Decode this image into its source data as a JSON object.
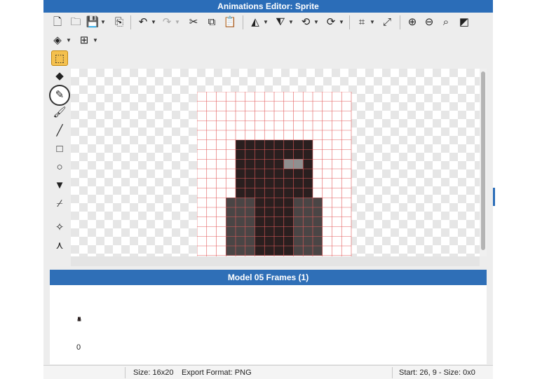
{
  "window": {
    "title": "Animations Editor: Sprite"
  },
  "toolbar": {
    "row1": [
      {
        "name": "new-file-icon",
        "glyph": "🗋"
      },
      {
        "name": "open-folder-icon",
        "glyph": "🗀"
      },
      {
        "name": "save-icon",
        "glyph": "💾"
      },
      {
        "name": "export-icon",
        "glyph": "⎘"
      },
      {
        "name": "undo-icon",
        "glyph": "↶"
      },
      {
        "name": "redo-icon",
        "glyph": "↷"
      },
      {
        "name": "cut-icon",
        "glyph": "✂"
      },
      {
        "name": "copy-icon",
        "glyph": "⧉"
      },
      {
        "name": "paste-icon",
        "glyph": "📋"
      },
      {
        "name": "flip-horizontal-icon",
        "glyph": "◭"
      },
      {
        "name": "flip-vertical-icon",
        "glyph": "⧨"
      },
      {
        "name": "rotate-left-icon",
        "glyph": "⟲"
      },
      {
        "name": "rotate-right-icon",
        "glyph": "⟳"
      },
      {
        "name": "crop-icon",
        "glyph": "⌗"
      },
      {
        "name": "resize-icon",
        "glyph": "⤢"
      },
      {
        "name": "zoom-in-icon",
        "glyph": "⊕"
      },
      {
        "name": "zoom-out-icon",
        "glyph": "⊖"
      },
      {
        "name": "zoom-fit-icon",
        "glyph": "⌕"
      },
      {
        "name": "invert-icon",
        "glyph": "◩"
      }
    ],
    "row2": [
      {
        "name": "layers-icon",
        "glyph": "◈"
      },
      {
        "name": "grid-icon",
        "glyph": "⊞"
      }
    ]
  },
  "tools": [
    {
      "name": "select-rect-tool",
      "glyph": "⬚",
      "active": true
    },
    {
      "name": "eraser-tool",
      "glyph": "◆"
    },
    {
      "name": "pencil-tool",
      "glyph": "✎"
    },
    {
      "name": "brush-tool",
      "glyph": "🖌"
    },
    {
      "name": "line-tool",
      "glyph": "╱"
    },
    {
      "name": "rectangle-tool",
      "glyph": "□"
    },
    {
      "name": "ellipse-tool",
      "glyph": "○"
    },
    {
      "name": "fill-bucket-tool",
      "glyph": "▼"
    },
    {
      "name": "eyedropper-tool",
      "glyph": "⌿"
    },
    {
      "name": "pivot-tool",
      "glyph": "✧"
    },
    {
      "name": "bones-tool",
      "glyph": "⋏"
    }
  ],
  "sprite": {
    "width": 16,
    "height": 20,
    "rows": [
      "................",
      "................",
      "................",
      "................",
      "................",
      "....88888888....",
      "....88888888....",
      "....88888GG8....",
      "....88888888....",
      "....88888888....",
      "....88888888....",
      "...3338888333...",
      "...3338888333...",
      "...3338888333...",
      "...3338888333...",
      "...3338888333...",
      "...3338888333...",
      "................",
      "................",
      "................"
    ],
    "palette": {
      "8": "#2a1f1f",
      "3": "#4a4545",
      "G": "#8f8f8f"
    },
    "grid_color": "#e35c5c"
  },
  "frames": {
    "title": "Model 05 Frames (1)",
    "items": [
      {
        "index": "0"
      }
    ]
  },
  "status": {
    "size": "Size: 16x20",
    "export_format": "Export Format: PNG",
    "position": "Start: 26, 9 - Size: 0x0"
  },
  "colors": {
    "title_bar": "#2b6db8",
    "frames_header": "#2f6fb7",
    "active_tool": "#f4c04e"
  }
}
